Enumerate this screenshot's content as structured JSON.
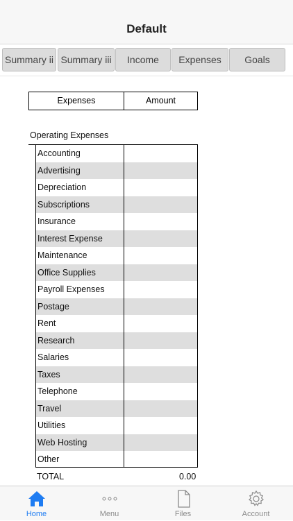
{
  "header": {
    "title": "Default"
  },
  "tabs": [
    {
      "label": "Summary ii"
    },
    {
      "label": "Summary iii"
    },
    {
      "label": "Income"
    },
    {
      "label": "Expenses"
    },
    {
      "label": "Goals"
    }
  ],
  "sheet": {
    "col_expenses": "Expenses",
    "col_amount": "Amount",
    "section_title": "Operating Expenses",
    "items": [
      "Accounting",
      "Advertising",
      "Depreciation",
      "Subscriptions",
      "Insurance",
      "Interest Expense",
      "Maintenance",
      "Office Supplies",
      "Payroll Expenses",
      "Postage",
      "Rent",
      "Research",
      "Salaries",
      "Taxes",
      "Telephone",
      "Travel",
      "Utilities",
      "Web Hosting",
      "Other"
    ],
    "total_label": "TOTAL",
    "total_value": "0.00"
  },
  "bottom_nav": [
    {
      "label": "Home",
      "icon": "home-icon",
      "active": true
    },
    {
      "label": "Menu",
      "icon": "ellipsis-icon",
      "active": false
    },
    {
      "label": "Files",
      "icon": "file-icon",
      "active": false
    },
    {
      "label": "Account",
      "icon": "gear-icon",
      "active": false
    }
  ],
  "colors": {
    "accent": "#1e7cf2",
    "row_alt": "#dedede",
    "tab_bg": "#dcdcdc"
  }
}
